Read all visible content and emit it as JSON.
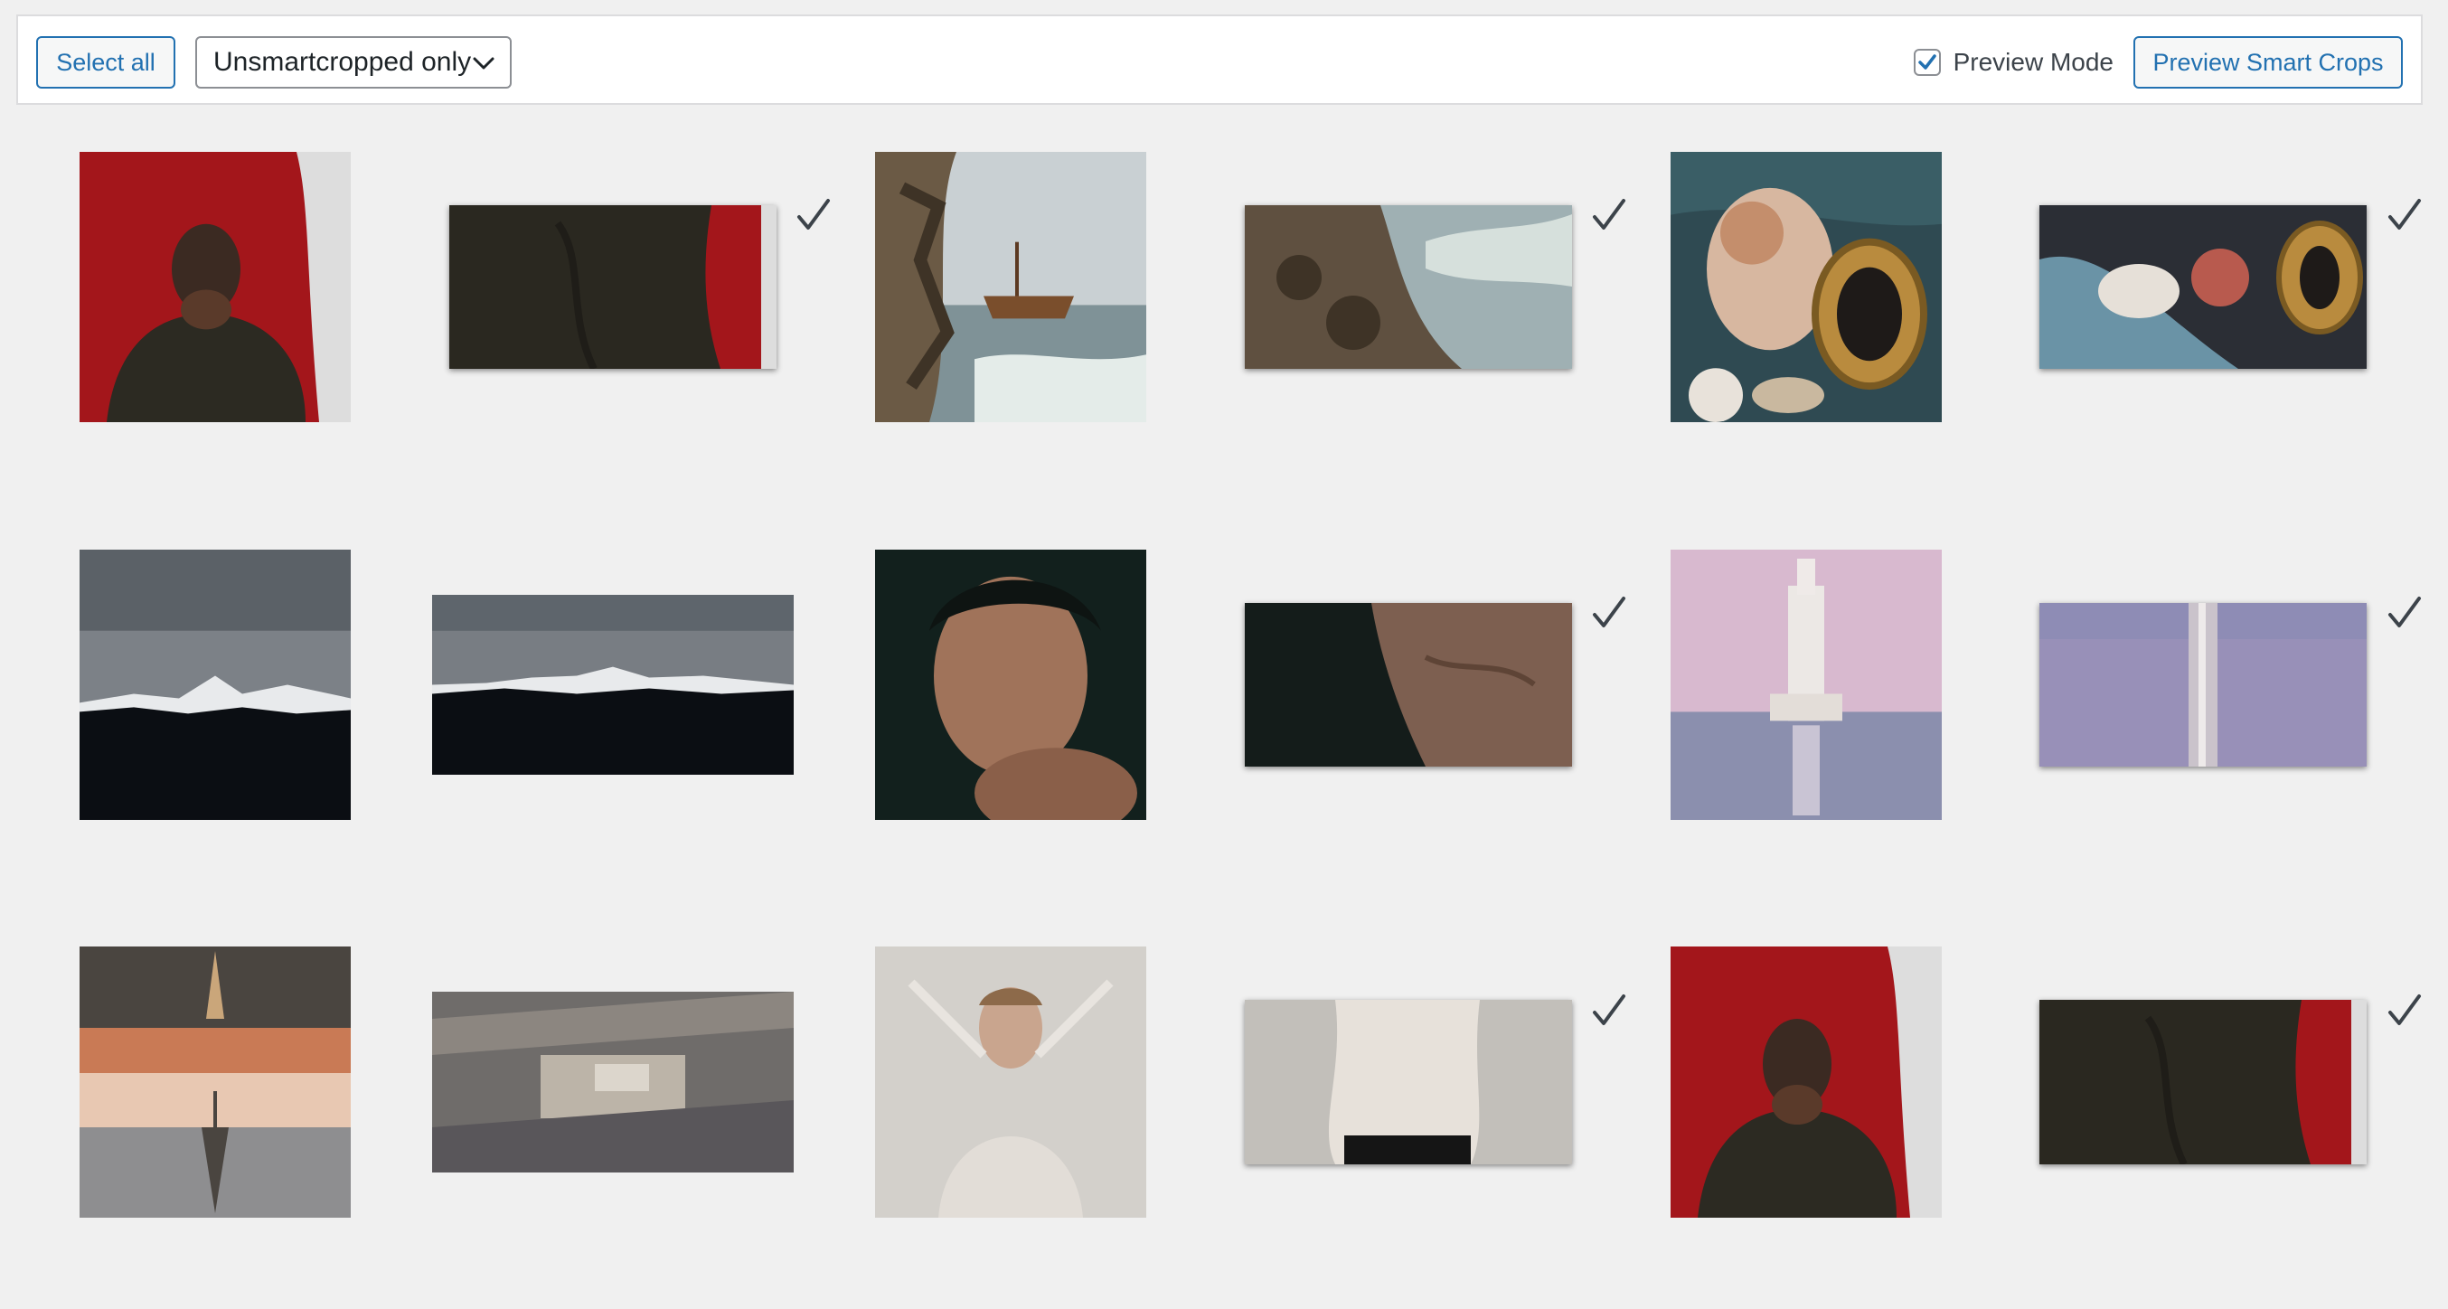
{
  "toolbar": {
    "select_all_label": "Select all",
    "filter_selected": "Unsmartcropped only",
    "preview_mode_label": "Preview Mode",
    "preview_mode_checked": true,
    "preview_button_label": "Preview Smart Crops"
  },
  "colors": {
    "accent": "#2271b1",
    "background": "#f0f0f0",
    "checkmark": "#3c434a"
  },
  "icons": {
    "dropdown": "chevron-down-icon",
    "checkbox": "checkmark-icon",
    "processed": "checkmark-icon"
  },
  "images": [
    {
      "subject": "portrait-red",
      "crop": "portrait-red-crop",
      "processed": true
    },
    {
      "subject": "shipwreck",
      "crop": "shipwreck-crop",
      "processed": true
    },
    {
      "subject": "baroque-painting",
      "crop": "baroque-crop",
      "processed": true
    },
    {
      "subject": "mountains",
      "crop": "mountains-crop",
      "processed": false
    },
    {
      "subject": "man-portrait",
      "crop": "man-crop",
      "processed": true
    },
    {
      "subject": "bell-tower",
      "crop": "bell-tower-crop",
      "processed": true
    },
    {
      "subject": "eiffel-reflection",
      "crop": "paris-crop",
      "processed": false
    },
    {
      "subject": "veil-portrait",
      "crop": "veil-crop",
      "processed": true
    },
    {
      "subject": "portrait-red",
      "crop": "portrait-red-crop",
      "processed": true
    }
  ]
}
